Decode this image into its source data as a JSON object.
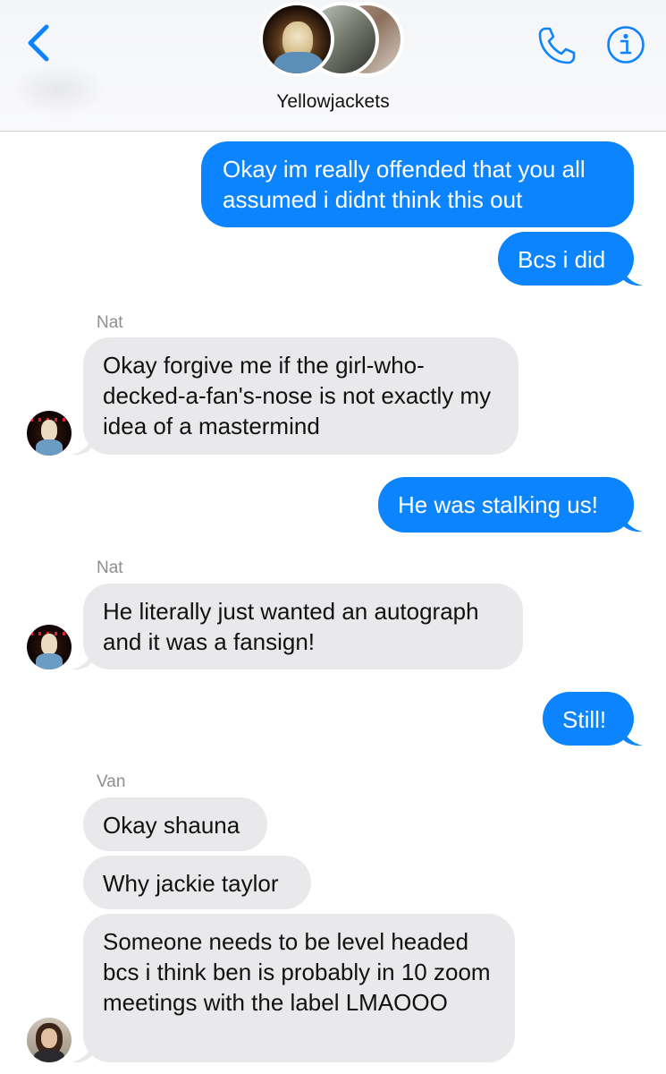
{
  "header": {
    "group_name": "Yellowjackets",
    "back_icon": "chevron-left-icon",
    "call_icon": "phone-icon",
    "info_icon": "info-icon",
    "accent_color": "#0b84fe"
  },
  "messages": [
    {
      "direction": "outgoing",
      "text": "Okay im really offended that you all assumed i didnt think this out"
    },
    {
      "direction": "outgoing",
      "text": "Bcs i did"
    },
    {
      "direction": "incoming",
      "sender": "Nat",
      "text": "Okay forgive me if the girl-who-decked-a-fan's-nose is not exactly my idea of a mastermind"
    },
    {
      "direction": "outgoing",
      "text": "He was stalking us!"
    },
    {
      "direction": "incoming",
      "sender": "Nat",
      "text": "He literally just wanted an autograph and it was a fansign!"
    },
    {
      "direction": "outgoing",
      "text": "Still!"
    },
    {
      "direction": "incoming",
      "sender": "Van",
      "text": "Okay shauna"
    },
    {
      "direction": "incoming",
      "sender": "Van",
      "text": "Why jackie taylor"
    },
    {
      "direction": "incoming",
      "sender": "Van",
      "text": "Someone needs to be level headed bcs i think ben is probably in 10 zoom meetings with the label LMAOOO"
    }
  ],
  "colors": {
    "outgoing_bubble": "#0b84fe",
    "incoming_bubble": "#e9e9eb",
    "sender_name": "#8e8e93"
  }
}
